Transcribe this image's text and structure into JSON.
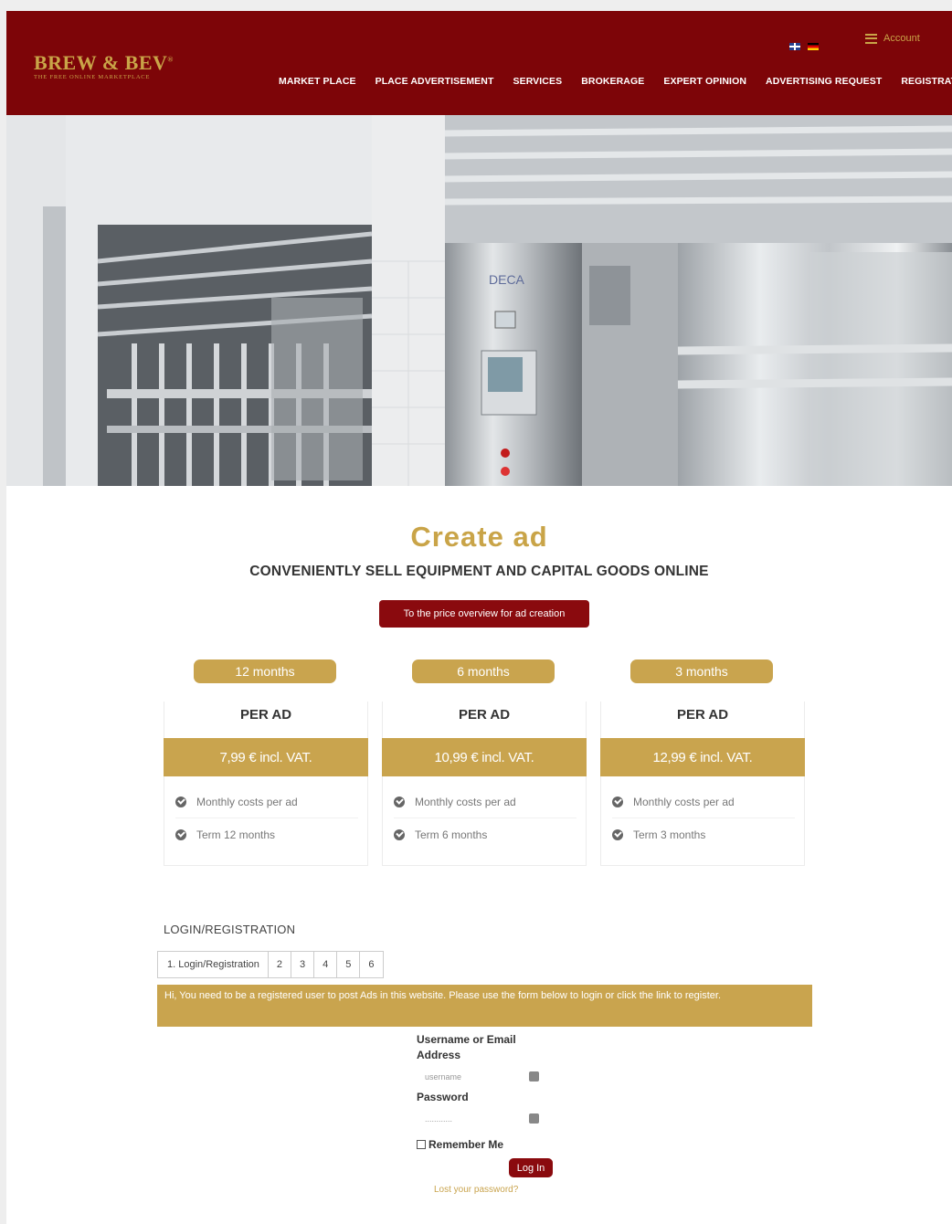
{
  "header": {
    "logo_main": "BREW & BEV",
    "logo_reg": "®",
    "logo_tagline": "THE FREE ONLINE MARKETPLACE",
    "account_label": "Account",
    "languages": [
      "uk-flag-icon",
      "de-flag-icon"
    ],
    "nav": [
      "MARKET PLACE",
      "PLACE ADVERTISEMENT",
      "SERVICES",
      "BROKERAGE",
      "EXPERT OPINION",
      "ADVERTISING REQUEST",
      "REGISTRATION"
    ]
  },
  "hero": {
    "panel_brand": "DECA"
  },
  "main": {
    "title": "Create ad",
    "subtitle": "CONVENIENTLY SELL EQUIPMENT AND CAPITAL GOODS ONLINE",
    "price_button": "To the price overview for ad creation",
    "plans": [
      {
        "term": "12 months",
        "per": "PER AD",
        "price": "7,99 € incl. VAT.",
        "features": [
          "Monthly costs per ad",
          "Term 12 months"
        ]
      },
      {
        "term": "6 months",
        "per": "PER AD",
        "price": "10,99 € incl. VAT.",
        "features": [
          "Monthly costs per ad",
          "Term 6 months"
        ]
      },
      {
        "term": "3 months",
        "per": "PER AD",
        "price": "12,99 € incl. VAT.",
        "features": [
          "Monthly costs per ad",
          "Term 3 months"
        ]
      }
    ]
  },
  "login": {
    "section_label": "LOGIN/REGISTRATION",
    "steps": [
      "1. Login/Registration",
      "2",
      "3",
      "4",
      "5",
      "6"
    ],
    "notice": "Hi, You need to be a registered user to post Ads in this website. Please use the form below to login or click the link to register.",
    "username_label": "Username or Email Address",
    "username_placeholder": "username",
    "password_label": "Password",
    "password_value": "............",
    "remember_label": "Remember Me",
    "login_button": "Log In",
    "lost_password": "Lost your password?"
  },
  "colors": {
    "brand_red": "#7d0508",
    "gold": "#c9a44e"
  }
}
